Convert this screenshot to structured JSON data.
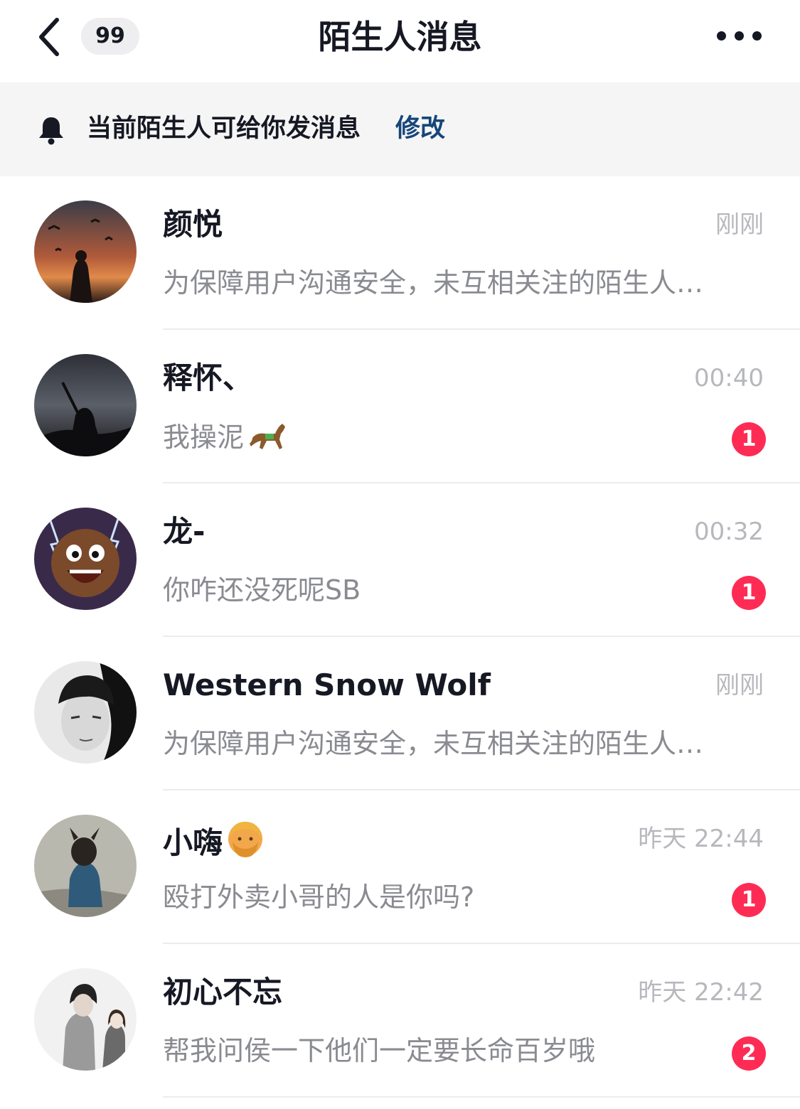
{
  "header": {
    "unread_count": "99",
    "title": "陌生人消息"
  },
  "notice": {
    "text": "当前陌生人可给你发消息",
    "link": "修改"
  },
  "conversations": [
    {
      "name": "颜悦",
      "time": "刚刚",
      "preview": "为保障用户沟通安全，未互相关注的陌生人…",
      "badge": ""
    },
    {
      "name": "释怀、",
      "time": "00:40",
      "preview": "我操泥",
      "badge": "1"
    },
    {
      "name": "龙-",
      "time": "00:32",
      "preview": "你咋还没死呢SB",
      "badge": "1"
    },
    {
      "name": "Western Snow Wolf",
      "time": "刚刚",
      "preview": "为保障用户沟通安全，未互相关注的陌生人…",
      "badge": ""
    },
    {
      "name": "小嗨",
      "time": "昨天 22:44",
      "preview": "殴打外卖小哥的人是你吗?",
      "badge": "1"
    },
    {
      "name": "初心不忘",
      "time": "昨天 22:42",
      "preview": "帮我问侯一下他们一定要长命百岁哦",
      "badge": "2"
    }
  ],
  "icons": {
    "back": "chevron-left-icon",
    "more": "more-dots-icon",
    "bell": "bell-icon",
    "horse_emoji": "horse-emoji-icon",
    "man_emoji": "man-emoji-icon"
  },
  "colors": {
    "accent_link": "#16457a",
    "badge": "#fe2c55",
    "banner_bg": "#f5f5f5"
  }
}
